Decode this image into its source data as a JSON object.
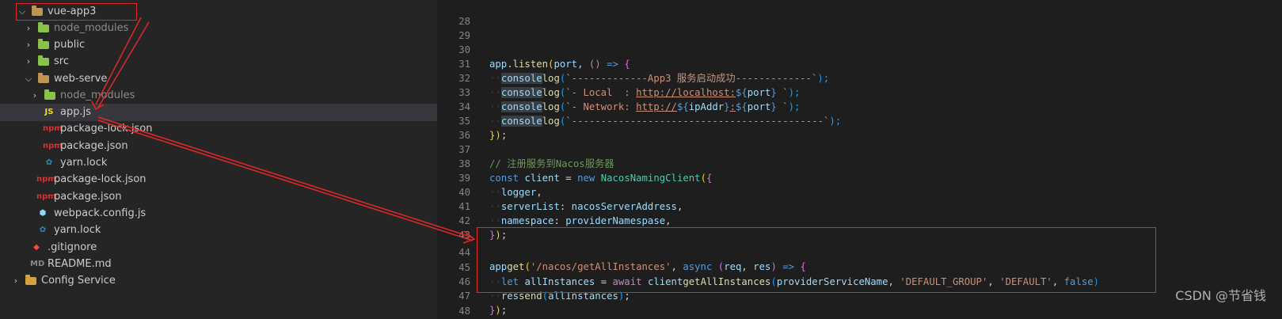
{
  "explorer": {
    "items": [
      {
        "label": "vue-app3",
        "chevron": "chevron-down",
        "icon": "folder-open-icon"
      },
      {
        "label": "node_modules",
        "chevron": "chevron-right",
        "icon": "node-folder-icon"
      },
      {
        "label": "public",
        "chevron": "chevron-right",
        "icon": "public-folder-icon"
      },
      {
        "label": "src",
        "chevron": "chevron-right",
        "icon": "src-folder-icon"
      },
      {
        "label": "web-serve",
        "chevron": "chevron-down",
        "icon": "folder-open-icon"
      },
      {
        "label": "node_modules",
        "chevron": "chevron-right",
        "icon": "node-folder-icon"
      },
      {
        "label": "app.js",
        "icon_text": "JS",
        "icon": "javascript-file-icon"
      },
      {
        "label": "package-lock.json",
        "icon_text": "npm",
        "icon": "npm-file-icon"
      },
      {
        "label": "package.json",
        "icon_text": "npm",
        "icon": "npm-file-icon"
      },
      {
        "label": "yarn.lock",
        "icon": "yarn-file-icon"
      },
      {
        "label": "package-lock.json",
        "icon_text": "npm",
        "icon": "npm-file-icon"
      },
      {
        "label": "package.json",
        "icon_text": "npm",
        "icon": "npm-file-icon"
      },
      {
        "label": "webpack.config.js",
        "icon": "webpack-file-icon"
      },
      {
        "label": "yarn.lock",
        "icon": "yarn-file-icon"
      },
      {
        "label": ".gitignore",
        "icon": "git-file-icon"
      },
      {
        "label": "README.md",
        "icon_text": "MD",
        "icon": "markdown-file-icon"
      },
      {
        "label": "Config Service",
        "chevron": "chevron-right",
        "icon": "config-folder-icon"
      }
    ]
  },
  "editor": {
    "line_numbers": [
      "28",
      "29",
      "30",
      "31",
      "32",
      "33",
      "34",
      "35",
      "36",
      "37",
      "38",
      "39",
      "40",
      "41",
      "42",
      "43",
      "44",
      "45",
      "46",
      "47",
      "48"
    ],
    "l30": {
      "a": "app",
      "b": ".",
      "c": "listen",
      "d": "(",
      "e": "port",
      ",": ",",
      "f": "()",
      "g": "=>",
      "h": "{"
    },
    "l31": {
      "a": "console",
      ".": ".",
      "b": "log",
      "c": "(",
      "d": "`-------------App3 服务启动成功-------------`",
      "e": ");"
    },
    "l32": {
      "a": "console",
      ".": ".",
      "b": "log",
      "c": "(",
      "d": "`- Local  : ",
      "e": "http://localhost:",
      "f": "${",
      "g": "port",
      "h": "}",
      "i": " `",
      "j": ");"
    },
    "l33": {
      "a": "console",
      ".": ".",
      "b": "log",
      "c": "(",
      "d": "`- Network: ",
      "e": "http://",
      "f": "${",
      "g": "ipAddr",
      "h": "}",
      ":": ":",
      "i": "${",
      "j": "port",
      "k": "}",
      "l": " `",
      "m": ");"
    },
    "l34": {
      "a": "console",
      ".": ".",
      "b": "log",
      "c": "(",
      "d": "`-------------------------------------------`",
      "e": ");"
    },
    "l35": {
      "a": "})",
      ";": ";"
    },
    "l37": {
      "a": "// 注册服务到Nacos服务器"
    },
    "l38": {
      "a": "const",
      "b": "client",
      "c": "=",
      "d": "new",
      "e": "NacosNamingClient",
      "f": "(",
      "g": "{"
    },
    "l39": {
      "a": "logger",
      ",": ","
    },
    "l40": {
      "a": "serverList",
      ":": ":",
      "b": "nacosServerAddress",
      ",": ","
    },
    "l41": {
      "a": "namespace",
      ":": ":",
      "b": "providerNamespase",
      ",": ","
    },
    "l42": {
      "a": "}",
      "b": ")",
      ";": ";"
    },
    "l44": {
      "a": "app",
      ".": ".",
      "b": "get",
      "c": "(",
      "d": "'/nacos/getAllInstances'",
      ",": ",",
      "e": "async",
      "f": "(",
      "g": "req",
      "h": "res",
      "i": ")",
      "j": "=>",
      "k": "{"
    },
    "l45": {
      "a": "let",
      "b": "allInstances",
      "c": "=",
      "d": "await",
      "e": "client",
      ".": ".",
      "f": "getAllInstances",
      "g": "(",
      "h": "providerServiceName",
      "i": ",",
      "j": "'DEFAULT_GROUP'",
      "k": ",",
      "l": "'DEFAULT'",
      "m": ",",
      "n": "false",
      "o": ")"
    },
    "l46": {
      "a": "res",
      ".": ".",
      "b": "send",
      "c": "(",
      "d": "allInstances",
      "e": ")",
      ";": ";"
    },
    "l47": {
      "a": "}",
      "b": ")",
      ";": ";"
    },
    "l48": {
      "a": "/*"
    }
  },
  "watermark": "CSDN @节省钱",
  "colors": {
    "annotation_red": "#e0282a",
    "sidebar_bg": "#252526",
    "editor_bg": "#1e1e1e"
  }
}
